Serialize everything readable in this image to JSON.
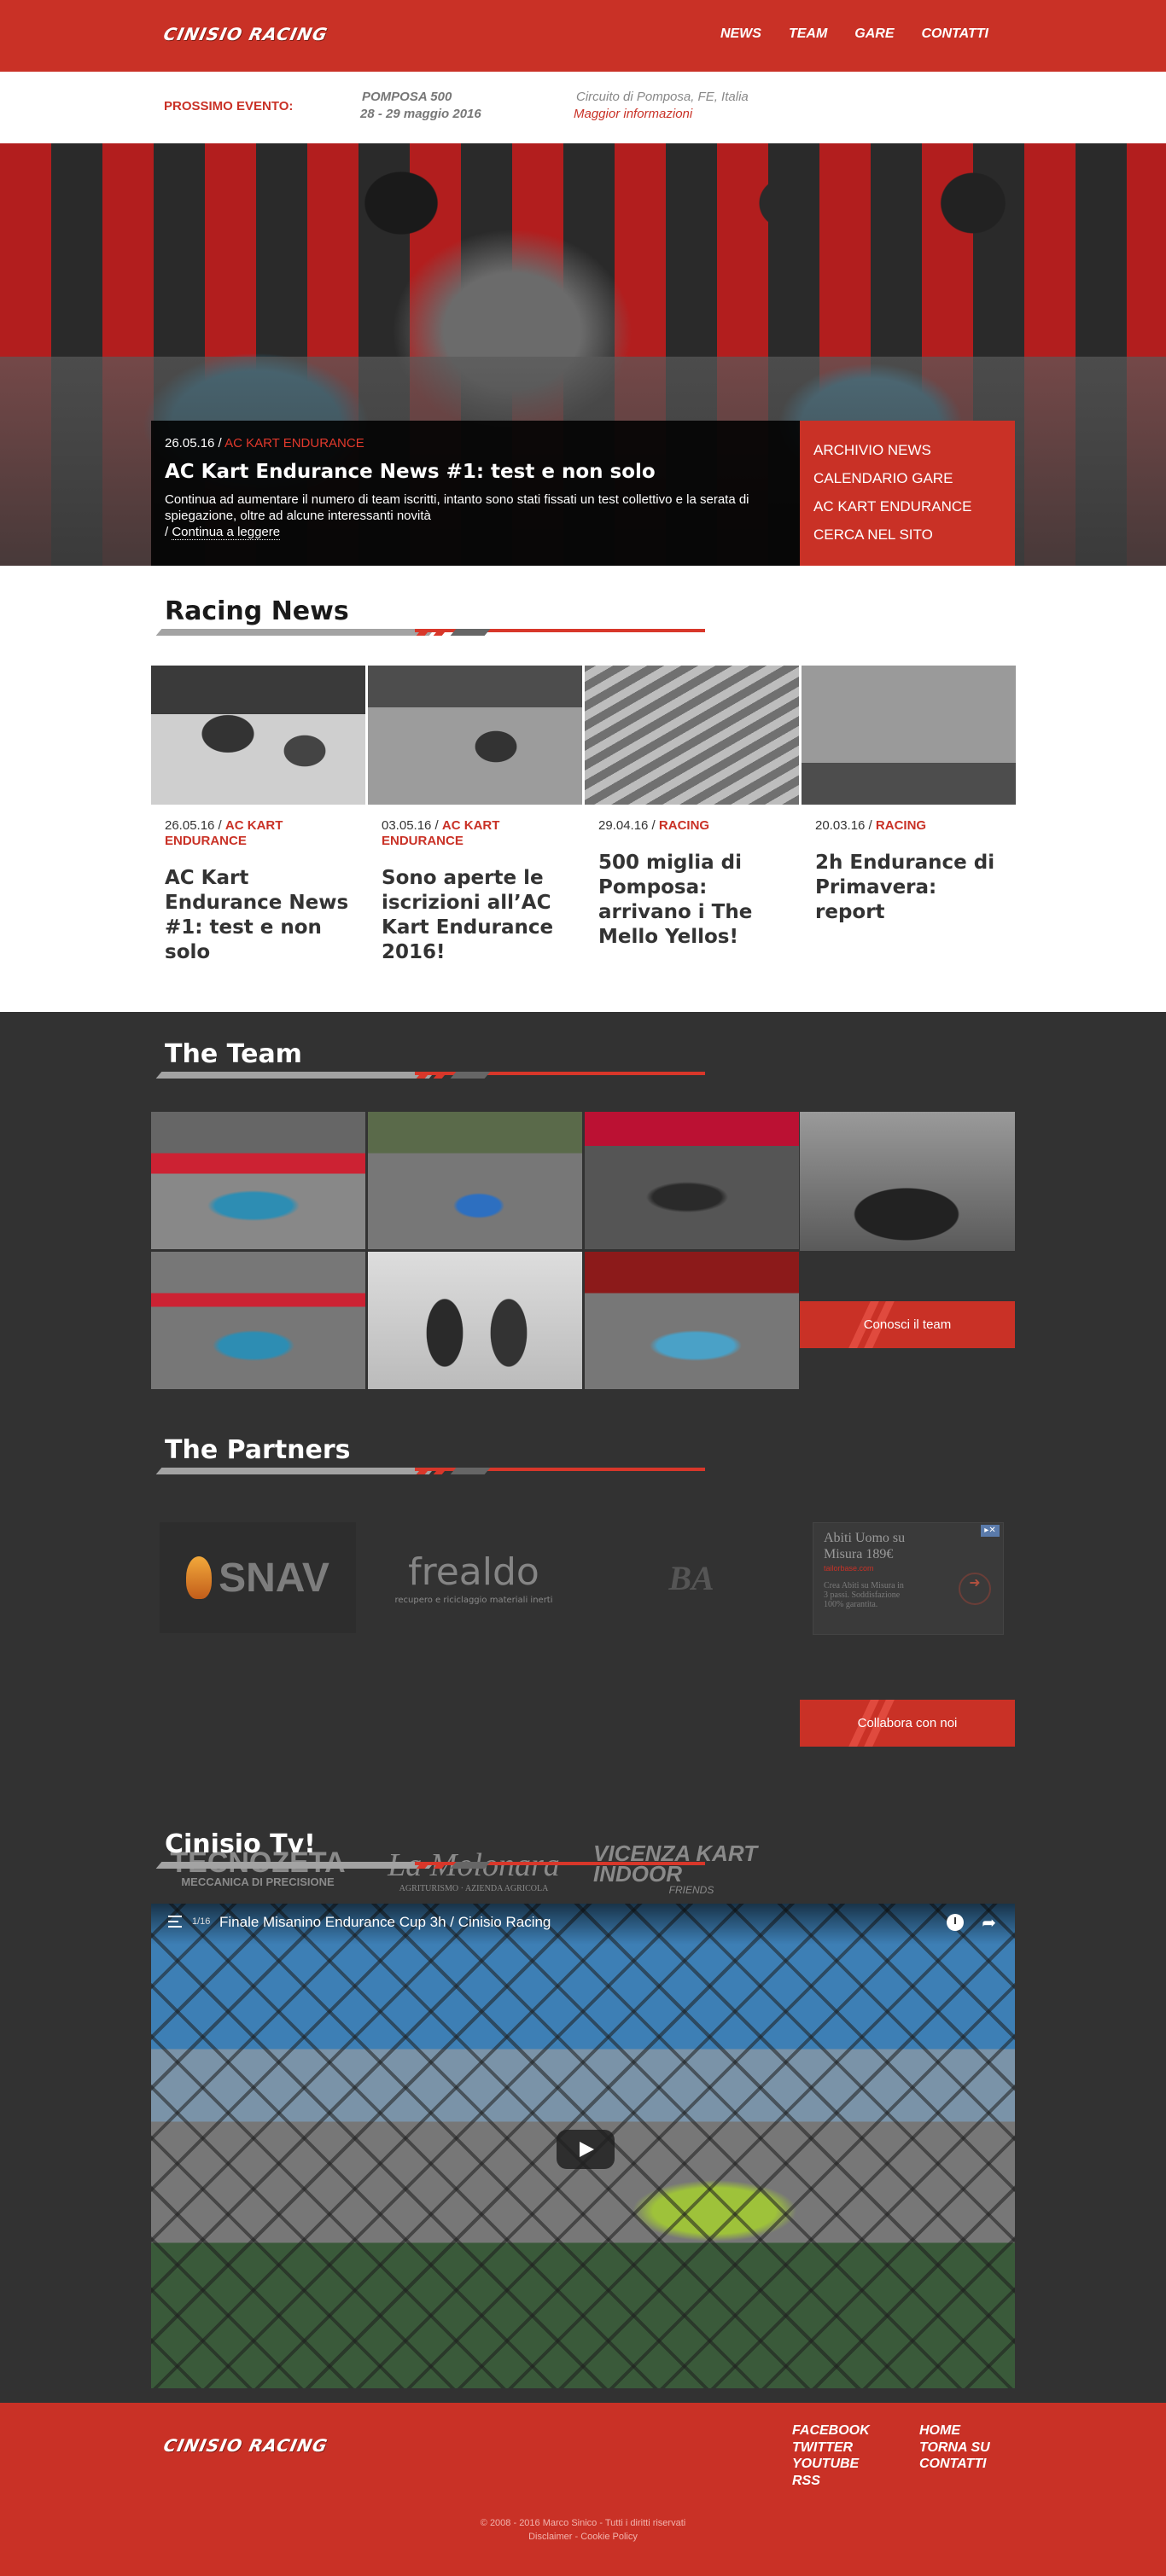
{
  "site": {
    "logo_text": "CINISIO RACING"
  },
  "nav": {
    "items": [
      "NEWS",
      "TEAM",
      "GARE",
      "CONTATTI"
    ]
  },
  "event": {
    "label": "PROSSIMO EVENTO:",
    "name": "POMPOSA 500",
    "dates": "28 - 29 maggio 2016",
    "place": "Circuito di Pomposa, FE, Italia",
    "more": "Maggior informazioni"
  },
  "hero": {
    "date": "26.05.16 / ",
    "category": "AC KART ENDURANCE",
    "title": "AC Kart Endurance News #1: test e non solo",
    "excerpt": "Continua ad aumentare il numero di team iscritti, intanto sono stati fissati un test collettivo e la serata di spiegazione, oltre ad alcune interessanti novità",
    "more_prefix": "/ ",
    "more": "Continua a leggere",
    "menu": [
      "ARCHIVIO NEWS",
      "CALENDARIO GARE",
      "AC KART ENDURANCE",
      "CERCA NEL SITO"
    ]
  },
  "news": {
    "title": "Racing News",
    "cards": [
      {
        "date": "26.05.16 / ",
        "category": "AC KART ENDURANCE",
        "title": "AC Kart Endurance News #1: test e non solo"
      },
      {
        "date": "03.05.16 / ",
        "category": "AC KART ENDURANCE",
        "title": "Sono aperte le iscrizioni all’AC Kart Endurance 2016!"
      },
      {
        "date": "29.04.16 / ",
        "category": "RACING",
        "title": "500 miglia di Pomposa: arrivano i The Mello Yellos!"
      },
      {
        "date": "20.03.16 / ",
        "category": "RACING",
        "title": "2h Endurance di Primavera: report"
      }
    ]
  },
  "team": {
    "title": "The Team",
    "button": "Conosci il team"
  },
  "partners": {
    "title": "The Partners",
    "logos": {
      "snav": "SNAV",
      "frealdo": "frealdo",
      "frealdo_sub": "recupero e riciclaggio materiali inerti",
      "ba": "BA",
      "tecnozeta": "TECNOZETA",
      "tecnozeta_sub": "MECCANICA DI PRECISIONE",
      "molonara": "La Molonara",
      "molonara_sub": "AGRITURISMO · AZIENDA AGRICOLA",
      "vki": "VICENZA KART INDOOR",
      "vki_sub": "FRIENDS"
    },
    "ad": {
      "title": "Abiti Uomo su Misura 189€",
      "url": "tailorbase.com",
      "text": "Crea Abiti su Misura in 3 passi. Soddisfazione 100% garantita."
    },
    "button": "Collabora con noi"
  },
  "tv": {
    "title": "Cinisio Tv!",
    "video_count": "1/16",
    "video_title": "Finale Misanino Endurance Cup 3h / Cinisio Racing"
  },
  "footer": {
    "logo_text": "CINISIO RACING",
    "social": [
      "FACEBOOK",
      "TWITTER",
      "YOUTUBE",
      "RSS"
    ],
    "links": [
      "HOME",
      "TORNA SU",
      "CONTATTI"
    ],
    "copyright": "© 2008 - 2016 Marco Sinico - Tutti i diritti riservati",
    "disclaimer": "Disclaimer",
    "separator": " - ",
    "cookie": "Cookie Policy"
  },
  "colors": {
    "brand_red": "#c93126",
    "dark_bg": "#323232"
  }
}
